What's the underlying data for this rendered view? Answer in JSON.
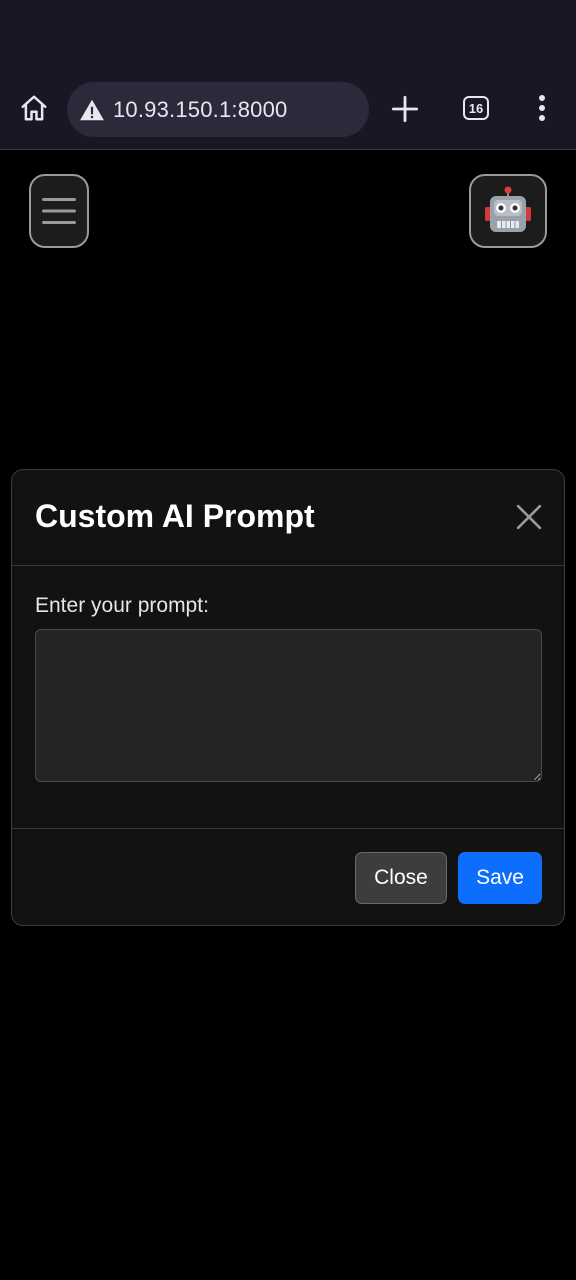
{
  "browser": {
    "url": "10.93.150.1:8000",
    "tab_count": "16",
    "icons": {
      "home": "home-icon",
      "warning": "warning-icon",
      "new_tab": "plus-icon",
      "tabs": "tabs-icon",
      "menu": "more-vert-icon"
    }
  },
  "page": {
    "menu_icon": "hamburger-icon",
    "robot_icon": "robot-icon"
  },
  "modal": {
    "title": "Custom AI Prompt",
    "close_icon": "close-icon",
    "prompt_label": "Enter your prompt:",
    "prompt_value": "",
    "close_button": "Close",
    "save_button": "Save"
  },
  "colors": {
    "browser_bg": "#1a1725",
    "url_pill_bg": "#2b2a3a",
    "modal_bg": "#121212",
    "save_blue": "#0d6efd",
    "close_gray": "#3d3d3d"
  }
}
